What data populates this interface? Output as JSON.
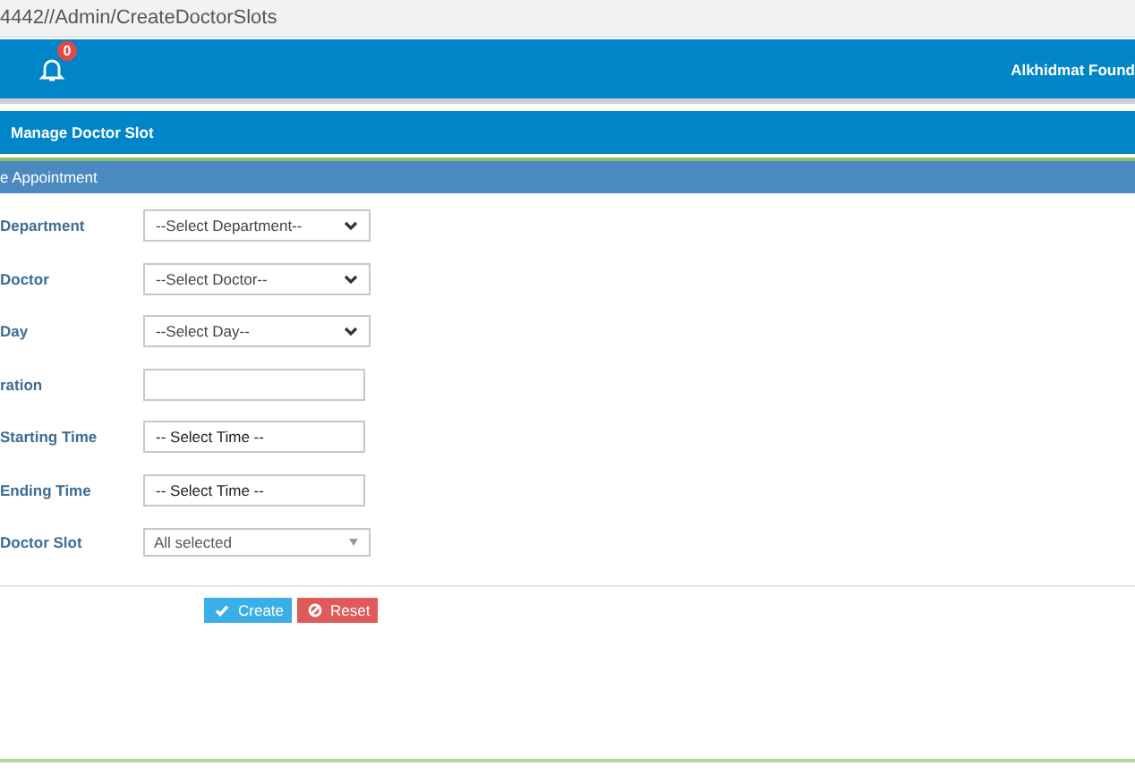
{
  "address_bar": {
    "url": "4442//Admin/CreateDoctorSlots"
  },
  "header": {
    "notification_count": "0",
    "organization": "Alkhidmat Found"
  },
  "page_title": "Manage Doctor Slot",
  "section_title": "e Appointment",
  "fields": [
    {
      "label": "Department",
      "kind": "select",
      "value": "--Select Department--"
    },
    {
      "label": "Doctor",
      "kind": "select",
      "value": "--Select Doctor--"
    },
    {
      "label": "Day",
      "kind": "select",
      "value": "--Select Day--"
    },
    {
      "label": "ration",
      "kind": "input"
    },
    {
      "label": "Starting Time",
      "kind": "input",
      "value": "-- Select Time --"
    },
    {
      "label": "Ending Time",
      "kind": "input",
      "value": "-- Select Time --"
    },
    {
      "label": "Doctor Slot",
      "kind": "multiselect",
      "value": "All selected"
    }
  ],
  "buttons": [
    {
      "label": "Create",
      "kind": "primary"
    },
    {
      "label": "Reset",
      "kind": "danger"
    }
  ]
}
